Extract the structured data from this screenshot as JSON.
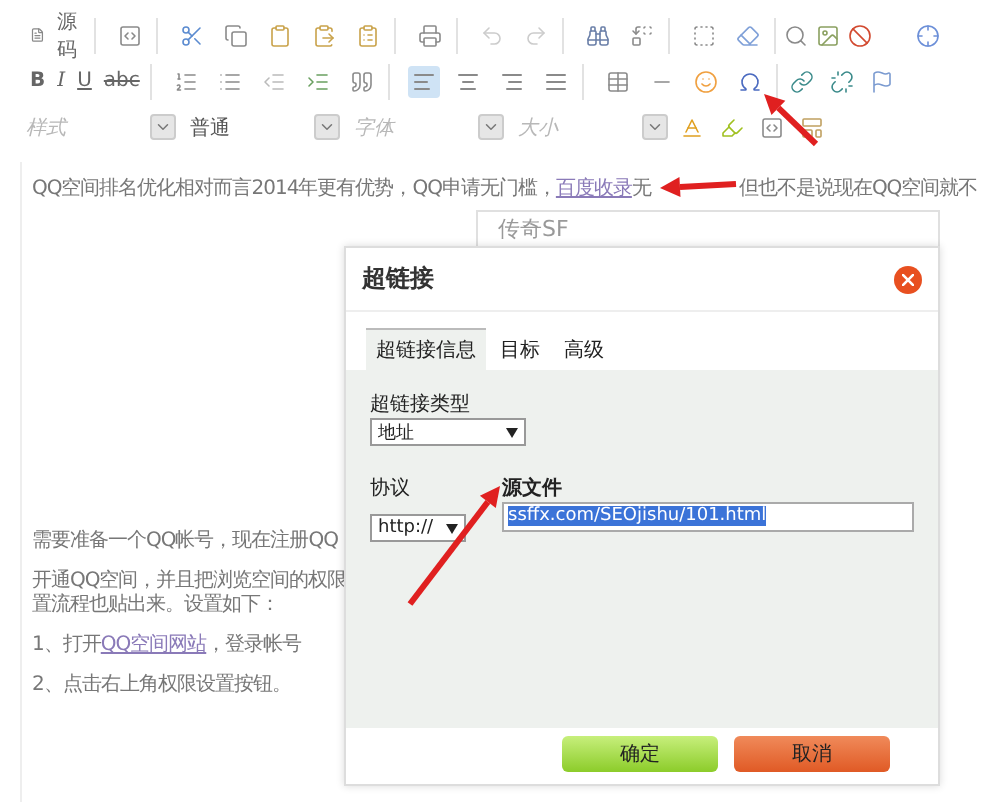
{
  "toolbar": {
    "source_label": "源码",
    "format_buttons": [
      {
        "label": "B",
        "kind": "bold"
      },
      {
        "label": "I",
        "kind": "italic"
      },
      {
        "label": "U",
        "kind": "underline"
      },
      {
        "label": "abc",
        "kind": "strike"
      }
    ],
    "alignment": [
      {
        "kind": "left",
        "selected": true
      },
      {
        "kind": "center",
        "selected": false
      },
      {
        "kind": "right",
        "selected": false
      },
      {
        "kind": "justify",
        "selected": false
      }
    ],
    "dropdowns": [
      {
        "label": "样式",
        "kind": "placeholder"
      },
      {
        "label": "普通",
        "kind": "value"
      },
      {
        "label": "字体",
        "kind": "placeholder"
      },
      {
        "label": "大小",
        "kind": "placeholder"
      }
    ]
  },
  "content": {
    "intro": {
      "before": "QQ空间排名优化相对而言2014年更有优势，QQ申请无门槛，",
      "link": "百度收录",
      "after": "无",
      "tail": "但也不是说现在QQ空间就不"
    },
    "embedded_box": "传奇SF",
    "paragraphs": [
      {
        "lines": [
          "需要准备一个QQ帐号，现在注册QQ"
        ]
      },
      {
        "lines": [
          "开通QQ空间，并且把浏览空间的权限",
          "置流程也贴出来。设置如下："
        ]
      },
      {
        "lines": [
          "1、打开"
        ],
        "link": "QQ空间网站",
        "after": "，登录帐号"
      },
      {
        "lines": [
          "2、点击右上角权限设置按钮。"
        ]
      }
    ]
  },
  "dialog": {
    "title": "超链接",
    "tabs": [
      {
        "label": "超链接信息",
        "selected": true
      },
      {
        "label": "目标",
        "selected": false
      },
      {
        "label": "高级",
        "selected": false
      }
    ],
    "link_type_label": "超链接类型",
    "link_type": "地址",
    "protocol_label": "协议",
    "protocol": "http://",
    "url_label": "源文件",
    "url": "ssffx.com/SEOjishu/101.html",
    "buttons": [
      {
        "label": "确定",
        "kind": "ok"
      },
      {
        "label": "取消",
        "kind": "cancel"
      }
    ]
  }
}
